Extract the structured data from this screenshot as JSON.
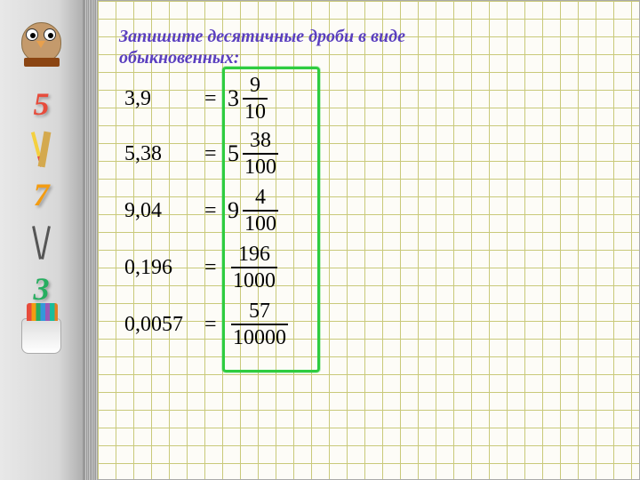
{
  "title_line1": "Запишите десятичные дроби в виде",
  "title_line2": "обыкновенных:",
  "sidebar": {
    "digits": [
      "5",
      "7",
      "3"
    ],
    "colors": [
      "#e74c3c",
      "#f39c12",
      "#27ae60"
    ]
  },
  "problems": [
    {
      "decimal": "3,9",
      "whole": "3",
      "num": "9",
      "den": "10"
    },
    {
      "decimal": "5,38",
      "whole": "5",
      "num": "38",
      "den": "100"
    },
    {
      "decimal": "9,04",
      "whole": "9",
      "num": "4",
      "den": "100"
    },
    {
      "decimal": "0,196",
      "whole": "",
      "num": "196",
      "den": "1000"
    },
    {
      "decimal": "0,0057",
      "whole": "",
      "num": "57",
      "den": "10000"
    }
  ]
}
